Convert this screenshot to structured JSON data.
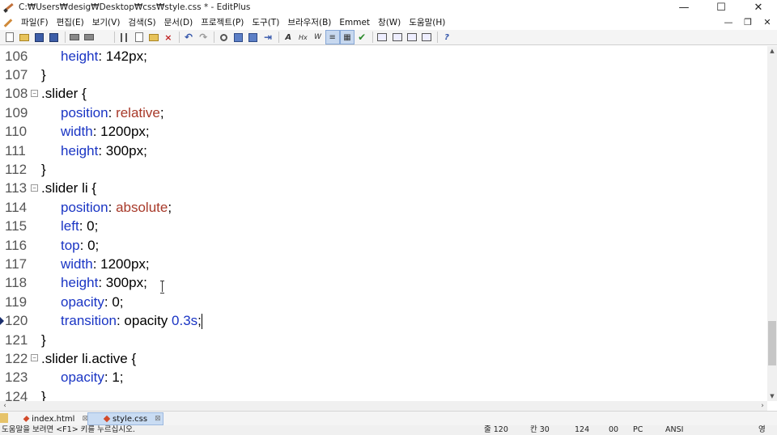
{
  "window": {
    "title": "C:₩Users₩desig₩Desktop₩css₩style.css * - EditPlus",
    "minimize": "—",
    "maximize": "☐",
    "close": "✕"
  },
  "menu": {
    "items": [
      "파일(F)",
      "편집(E)",
      "보기(V)",
      "검색(S)",
      "문서(D)",
      "프로젝트(P)",
      "도구(T)",
      "브라우저(B)",
      "Emmet",
      "창(W)",
      "도움말(H)"
    ],
    "mdi": {
      "minimize": "—",
      "restore": "❐",
      "close": "✕"
    }
  },
  "toolbar": {
    "icons": [
      "new-file-icon",
      "open-folder-icon",
      "save-icon",
      "save-all-icon",
      "sep",
      "print-preview-icon",
      "print-icon",
      "spell-check-icon",
      "sep",
      "cut-icon",
      "copy-icon",
      "paste-icon",
      "delete-icon",
      "sep",
      "undo-icon",
      "redo-icon",
      "sep",
      "find-icon",
      "replace-icon",
      "find-in-files-icon",
      "goto-icon",
      "sep",
      "font-icon",
      "hex-icon",
      "word-wrap-icon",
      "line-numbers-icon",
      "ruler-icon",
      "check-icon",
      "sep",
      "window-1-icon",
      "window-2-icon",
      "window-3-icon",
      "window-4-icon",
      "sep",
      "help-icon"
    ]
  },
  "editor": {
    "lines": [
      {
        "num": "106",
        "fold": false,
        "indent": true,
        "parts": [
          {
            "t": "height",
            "c": "prop"
          },
          {
            "t": ": 142px;",
            "c": ""
          }
        ]
      },
      {
        "num": "107",
        "fold": false,
        "indent": false,
        "parts": [
          {
            "t": "}",
            "c": ""
          }
        ]
      },
      {
        "num": "108",
        "fold": true,
        "indent": false,
        "parts": [
          {
            "t": ".slider {",
            "c": ""
          }
        ]
      },
      {
        "num": "109",
        "fold": false,
        "indent": true,
        "parts": [
          {
            "t": "position",
            "c": "prop"
          },
          {
            "t": ": ",
            "c": ""
          },
          {
            "t": "relative",
            "c": "val"
          },
          {
            "t": ";",
            "c": ""
          }
        ]
      },
      {
        "num": "110",
        "fold": false,
        "indent": true,
        "parts": [
          {
            "t": "width",
            "c": "prop"
          },
          {
            "t": ": 1200px;",
            "c": ""
          }
        ]
      },
      {
        "num": "111",
        "fold": false,
        "indent": true,
        "parts": [
          {
            "t": "height",
            "c": "prop"
          },
          {
            "t": ": 300px;",
            "c": ""
          }
        ]
      },
      {
        "num": "112",
        "fold": false,
        "indent": false,
        "parts": [
          {
            "t": "}",
            "c": ""
          }
        ]
      },
      {
        "num": "113",
        "fold": true,
        "indent": false,
        "parts": [
          {
            "t": ".slider li {",
            "c": ""
          }
        ]
      },
      {
        "num": "114",
        "fold": false,
        "indent": true,
        "parts": [
          {
            "t": "position",
            "c": "prop"
          },
          {
            "t": ": ",
            "c": ""
          },
          {
            "t": "absolute",
            "c": "val"
          },
          {
            "t": ";",
            "c": ""
          }
        ]
      },
      {
        "num": "115",
        "fold": false,
        "indent": true,
        "parts": [
          {
            "t": "left",
            "c": "prop"
          },
          {
            "t": ": 0;",
            "c": ""
          }
        ]
      },
      {
        "num": "116",
        "fold": false,
        "indent": true,
        "parts": [
          {
            "t": "top",
            "c": "prop"
          },
          {
            "t": ": 0;",
            "c": ""
          }
        ]
      },
      {
        "num": "117",
        "fold": false,
        "indent": true,
        "parts": [
          {
            "t": "width",
            "c": "prop"
          },
          {
            "t": ": 1200px;",
            "c": ""
          }
        ]
      },
      {
        "num": "118",
        "fold": false,
        "indent": true,
        "parts": [
          {
            "t": "height",
            "c": "prop"
          },
          {
            "t": ": 300px;",
            "c": ""
          }
        ]
      },
      {
        "num": "119",
        "fold": false,
        "indent": true,
        "parts": [
          {
            "t": "opacity",
            "c": "prop"
          },
          {
            "t": ": 0;",
            "c": ""
          }
        ]
      },
      {
        "num": "120",
        "fold": false,
        "indent": true,
        "current": true,
        "parts": [
          {
            "t": "transition",
            "c": "prop"
          },
          {
            "t": ": opacity ",
            "c": ""
          },
          {
            "t": "0.3s",
            "c": "prop"
          },
          {
            "t": ";",
            "c": ""
          }
        ]
      },
      {
        "num": "121",
        "fold": false,
        "indent": false,
        "parts": [
          {
            "t": "}",
            "c": ""
          }
        ]
      },
      {
        "num": "122",
        "fold": true,
        "indent": false,
        "parts": [
          {
            "t": ".slider li.active {",
            "c": ""
          }
        ]
      },
      {
        "num": "123",
        "fold": false,
        "indent": true,
        "parts": [
          {
            "t": "opacity",
            "c": "prop"
          },
          {
            "t": ": 1;",
            "c": ""
          }
        ]
      },
      {
        "num": "124",
        "fold": false,
        "indent": false,
        "parts": [
          {
            "t": "}",
            "c": ""
          }
        ]
      }
    ]
  },
  "tabs": [
    {
      "label": "index.html",
      "active": false
    },
    {
      "label": "style.css",
      "active": true
    }
  ],
  "status": {
    "help": "도움말을 보려면 <F1> 키를 누르십시오.",
    "line": "줄 120",
    "col": "칸 30",
    "total": "124",
    "code": "00",
    "mode": "PC",
    "encoding": "ANSI",
    "ime": "영"
  },
  "colors": {
    "property": "#1a35c4",
    "value": "#a83a2a",
    "active_tab": "#c9dcf3"
  }
}
